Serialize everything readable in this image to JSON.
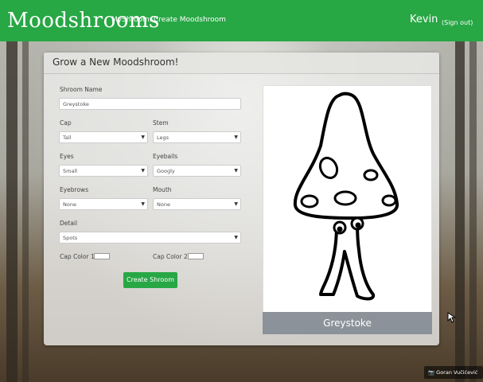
{
  "navbar": {
    "brand": "Moodshrooms",
    "links": [
      "MyShrooms",
      "Create Moodshroom"
    ],
    "user_name": "Kevin",
    "sign_out": "(Sign out)",
    "color": "#28a745"
  },
  "form": {
    "title": "Grow a New Moodshroom!",
    "name_label": "Shroom Name",
    "name_value": "Greystoke",
    "cap_label": "Cap",
    "cap_value": "Tall",
    "stem_label": "Stem",
    "stem_value": "Legs",
    "eyes_label": "Eyes",
    "eyes_value": "Small",
    "eyeballs_label": "Eyeballs",
    "eyeballs_value": "Googly",
    "eyebrows_label": "Eyebrows",
    "eyebrows_value": "None",
    "mouth_label": "Mouth",
    "mouth_value": "None",
    "detail_label": "Detail",
    "detail_value": "Spots",
    "cap_color1_label": "Cap Color 1",
    "cap_color1_value": "#ffffff",
    "cap_color2_label": "Cap Color 2",
    "cap_color2_value": "#ffffff",
    "create_button": "Create Shroom"
  },
  "preview": {
    "caption": "Greystoke"
  },
  "photo_credit": "Goran Vučićević"
}
